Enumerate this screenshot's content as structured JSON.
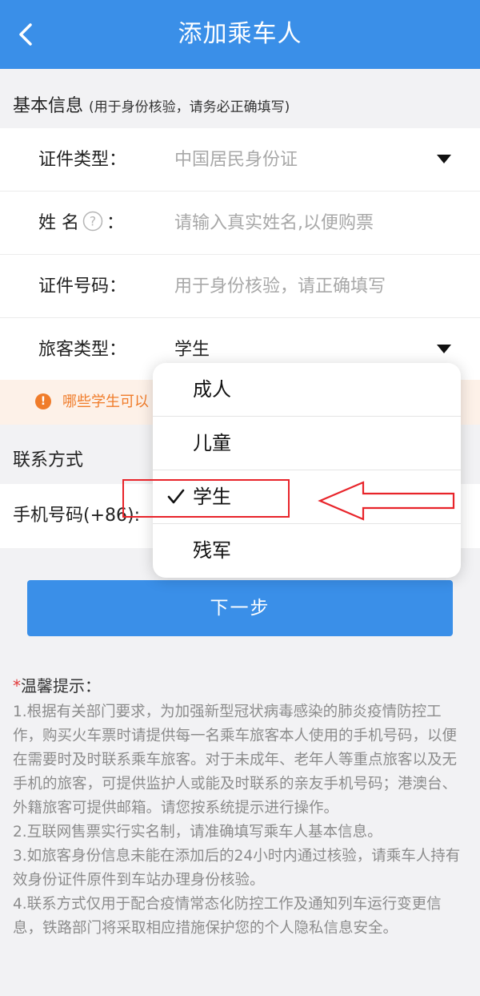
{
  "header": {
    "title": "添加乘车人",
    "back_icon": "chevron-left-icon"
  },
  "basic_info": {
    "title": "基本信息",
    "note": "(用于身份核验，请务必正确填写)",
    "fields": [
      {
        "label": "证件类型：",
        "value": "中国居民身份证",
        "type": "select"
      },
      {
        "label": "姓 名",
        "suffix": "：",
        "placeholder": "请输入真实姓名,以便购票",
        "type": "input"
      },
      {
        "label": "证件号码：",
        "placeholder": "用于身份核验，请正确填写",
        "type": "input"
      },
      {
        "label": "旅客类型：",
        "value": "学生",
        "type": "select"
      }
    ]
  },
  "notice": {
    "text": "哪些学生可以"
  },
  "contact": {
    "title": "联系方式",
    "phone_label": "手机号码(+86):"
  },
  "next_button": "下一步",
  "tips": {
    "title": "温馨提示：",
    "star": "*",
    "items": [
      "1.根据有关部门要求，为加强新型冠状病毒感染的肺炎疫情防控工作，购买火车票时请提供每一名乘车旅客本人使用的手机号码，以便在需要时及时联系乘车旅客。对于未成年、老年人等重点旅客以及无手机的旅客，可提供监护人或能及时联系的亲友手机号码；港澳台、外籍旅客可提供邮箱。请您按系统提示进行操作。",
      "2.互联网售票实行实名制，请准确填写乘车人基本信息。",
      "3.如旅客身份信息未能在添加后的24小时内通过核验，请乘车人持有效身份证件原件到车站办理身份核验。",
      "4.联系方式仅用于配合疫情常态化防控工作及通知列车运行变更信息，铁路部门将采取相应措施保护您的个人隐私信息安全。"
    ]
  },
  "dropdown": {
    "options": [
      "成人",
      "儿童",
      "学生",
      "残军"
    ],
    "selected": "学生"
  },
  "colors": {
    "primary": "#3a8fe8",
    "notice": "#f07c2a",
    "annotation": "#e8242a"
  }
}
